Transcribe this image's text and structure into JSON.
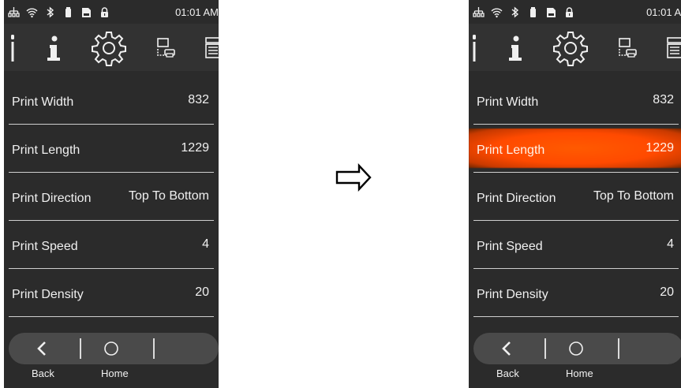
{
  "status": {
    "time": "01:01 AM",
    "icons": [
      "network-icon",
      "wifi-icon",
      "bluetooth-icon",
      "battery-icon",
      "sd-card-icon",
      "lock-icon"
    ]
  },
  "toolbar": {
    "items": [
      "tool-icon",
      "info-icon",
      "settings-gear-icon",
      "print-setup-icon",
      "label-icon"
    ]
  },
  "settings": [
    {
      "label": "Print Width",
      "value": "832"
    },
    {
      "label": "Print Length",
      "value": "1229"
    },
    {
      "label": "Print Direction",
      "value": "Top To Bottom"
    },
    {
      "label": "Print Speed",
      "value": "4"
    },
    {
      "label": "Print Density",
      "value": "20"
    }
  ],
  "nav": {
    "back_label": "Back",
    "home_label": "Home"
  },
  "highlight": {
    "row": "Print Length",
    "color": "#ff5200"
  },
  "colors": {
    "background": "#2b2b2b",
    "navbar": "#4a4a4a",
    "accent": "#ff5200"
  },
  "transition_arrow": "arrow-right-icon"
}
